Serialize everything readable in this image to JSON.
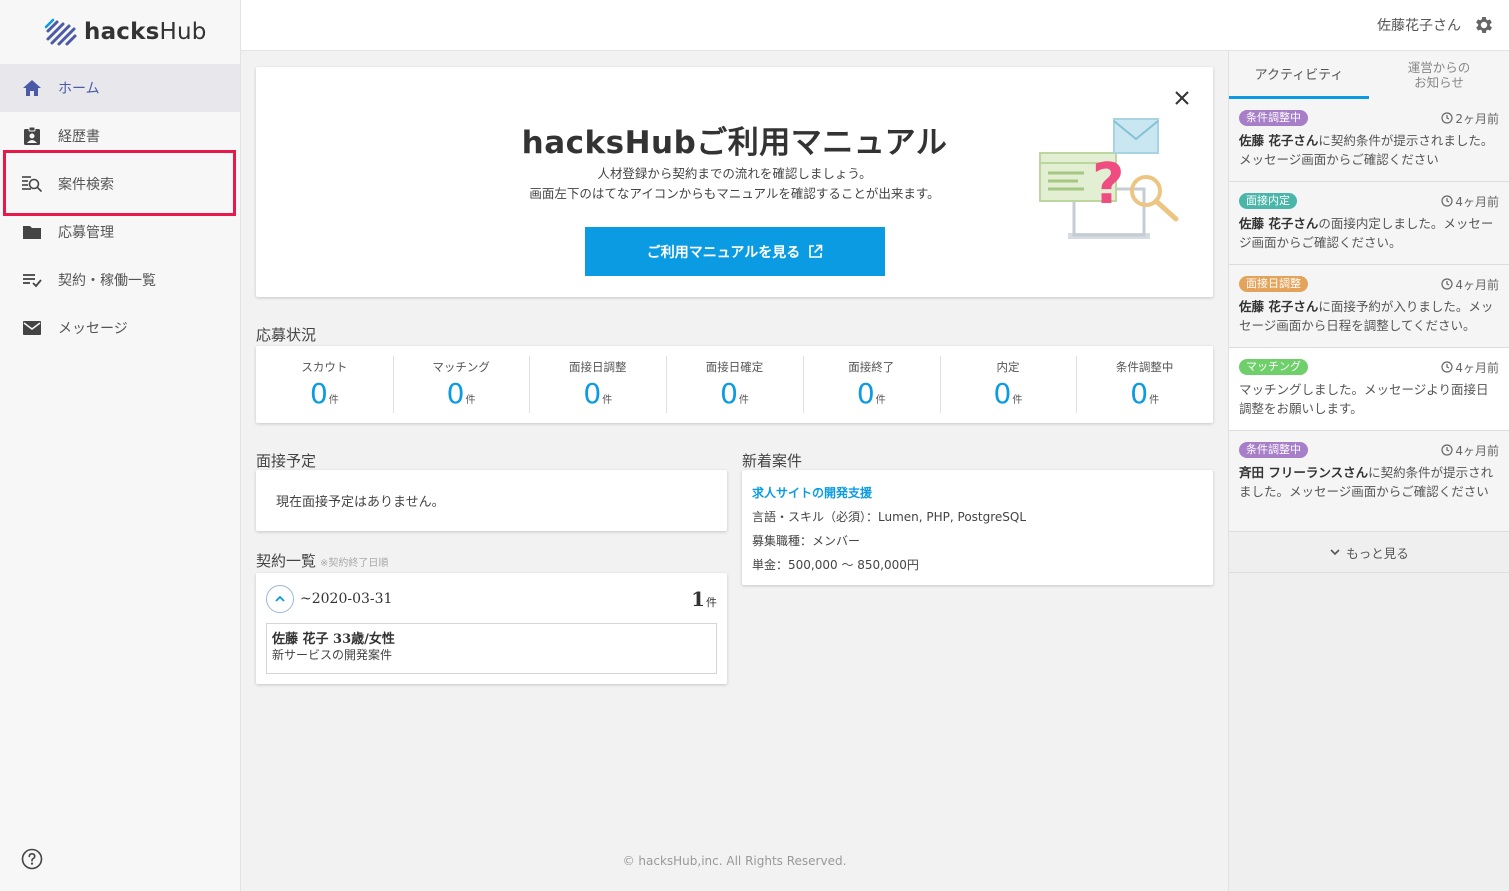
{
  "brand": {
    "logo_bold": "hacks",
    "logo_light": "Hub"
  },
  "header": {
    "user_name": "佐藤花子さん"
  },
  "sidebar": {
    "items": [
      {
        "label": "ホーム",
        "icon": "home-icon"
      },
      {
        "label": "経歴書",
        "icon": "clipboard-icon"
      },
      {
        "label": "案件検索",
        "icon": "search-list-icon"
      },
      {
        "label": "応募管理",
        "icon": "folder-icon"
      },
      {
        "label": "契約・稼働一覧",
        "icon": "list-check-icon"
      },
      {
        "label": "メッセージ",
        "icon": "mail-icon"
      }
    ]
  },
  "manual": {
    "title": "hacksHubご利用マニュアル",
    "desc_line1": "人材登録から契約までの流れを確認しましょう。",
    "desc_line2": "画面左下のはてなアイコンからもマニュアルを確認することが出来ます。",
    "button_label": "ご利用マニュアルを見る"
  },
  "status": {
    "title": "応募状況",
    "unit": "件",
    "cells": [
      {
        "label": "スカウト",
        "value": "0"
      },
      {
        "label": "マッチング",
        "value": "0"
      },
      {
        "label": "面接日調整",
        "value": "0"
      },
      {
        "label": "面接日確定",
        "value": "0"
      },
      {
        "label": "面接終了",
        "value": "0"
      },
      {
        "label": "内定",
        "value": "0"
      },
      {
        "label": "条件調整中",
        "value": "0"
      }
    ]
  },
  "interview": {
    "title": "面接予定",
    "empty": "現在面接予定はありません。"
  },
  "contracts": {
    "title": "契約一覧",
    "note": "※契約終了日順",
    "range": "~2020-03-31",
    "count": "1",
    "unit": "件",
    "item_name": "佐藤 花子 33歳/女性",
    "item_project": "新サービスの開発案件"
  },
  "newjobs": {
    "title": "新着案件",
    "job_title": "求人サイトの開発支援",
    "skills": "言語・スキル（必須）：Lumen, PHP, PostgreSQL",
    "role": "募集職種：メンバー",
    "price": "単金：500,000 ～ 850,000円"
  },
  "copyright": "© hacksHub,inc. All Rights Reserved.",
  "activity": {
    "tab_active": "アクティビティ",
    "tab_news_line1": "運営からの",
    "tab_news_line2": "お知らせ",
    "items": [
      {
        "badge": "条件調整中",
        "color": "#a77ec8",
        "time": "2ヶ月前",
        "bold": "佐藤 花子さん",
        "text": "に契約条件が提示されました。メッセージ画面からご確認ください"
      },
      {
        "badge": "面接内定",
        "color": "#4ab6aa",
        "time": "4ヶ月前",
        "bold": "佐藤 花子さん",
        "text": "の面接内定しました。メッセージ画面からご確認ください。"
      },
      {
        "badge": "面接日調整",
        "color": "#e4a35a",
        "time": "4ヶ月前",
        "bold": "佐藤 花子さん",
        "text": "に面接予約が入りました。メッセージ画面から日程を調整してください。"
      },
      {
        "badge": "マッチング",
        "color": "#6fcf6a",
        "time": "4ヶ月前",
        "bold": "",
        "text": "マッチングしました。メッセージより面接日調整をお願いします。"
      },
      {
        "badge": "条件調整中",
        "color": "#a77ec8",
        "time": "4ヶ月前",
        "bold": "斉田 フリーランスさん",
        "text": "に契約条件が提示されました。メッセージ画面からご確認ください"
      }
    ],
    "more_label": "もっと見る"
  }
}
